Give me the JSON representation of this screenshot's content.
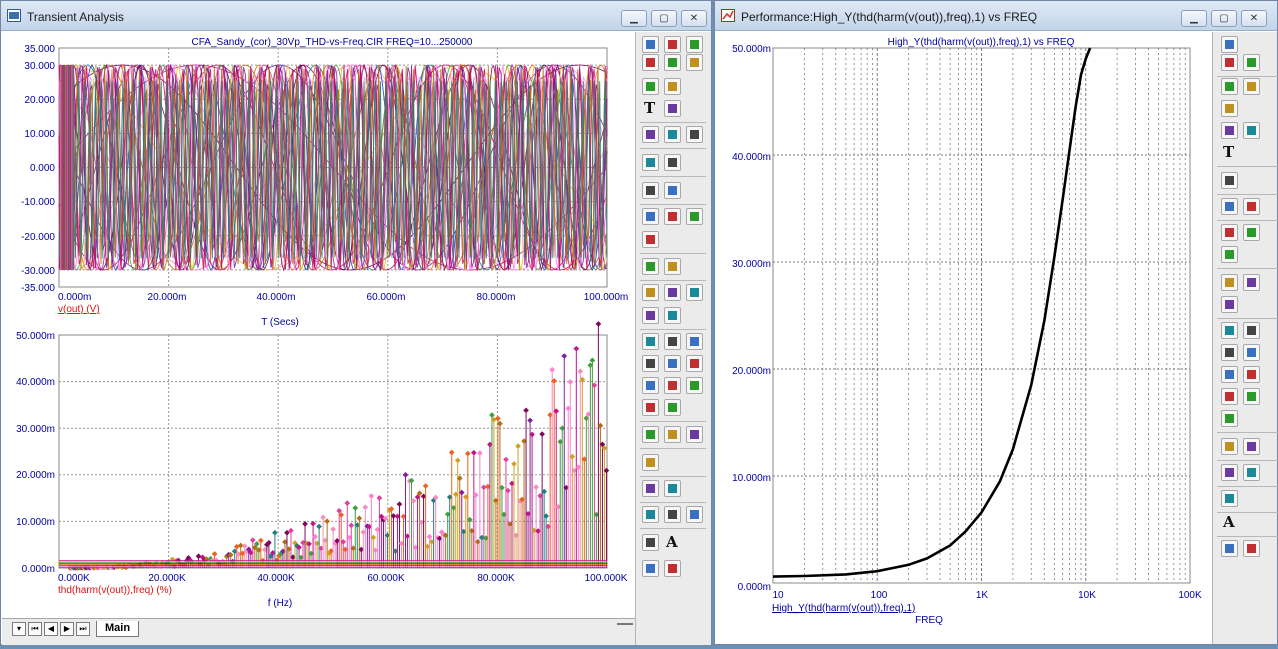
{
  "left_window": {
    "title": "Transient Analysis",
    "top_plot": {
      "title": "CFA_Sandy_(cor)_30Vp_THD-vs-Freq.CIR FREQ=10...250000",
      "y_ticks": [
        "35.000",
        "30.000",
        "20.000",
        "10.000",
        "0.000",
        "-10.000",
        "-20.000",
        "-30.000",
        "-35.000"
      ],
      "x_ticks": [
        "0.000m",
        "20.000m",
        "40.000m",
        "60.000m",
        "80.000m",
        "100.000m"
      ],
      "trace_label": "v(out) (V)",
      "x_label": "T (Secs)"
    },
    "bottom_plot": {
      "y_ticks": [
        "50.000m",
        "40.000m",
        "30.000m",
        "20.000m",
        "10.000m",
        "0.000m"
      ],
      "x_ticks": [
        "0.000K",
        "20.000K",
        "40.000K",
        "60.000K",
        "80.000K",
        "100.000K"
      ],
      "trace_label": "thd(harm(v(out)),freq) (%)",
      "x_label": "f (Hz)"
    },
    "tabs": [
      {
        "label": "Main"
      }
    ]
  },
  "right_window": {
    "title": "Performance:High_Y(thd(harm(v(out)),freq),1) vs FREQ",
    "plot_title": "High_Y(thd(harm(v(out)),freq),1) vs FREQ",
    "y_ticks": [
      "50.000m",
      "40.000m",
      "30.000m",
      "20.000m",
      "10.000m",
      "0.000m"
    ],
    "x_ticks": [
      "10",
      "100",
      "1K",
      "10K",
      "100K"
    ],
    "trace_label": "High_Y(thd(harm(v(out)),freq),1)",
    "x_label": "FREQ",
    "chart_data": {
      "type": "line",
      "title": "High_Y(thd(harm(v(out)),freq),1) vs FREQ",
      "xlabel": "FREQ",
      "ylabel": "",
      "x_scale": "log",
      "xlim": [
        10,
        100000
      ],
      "ylim": [
        0,
        0.05
      ],
      "series": [
        {
          "name": "High_Y(thd(harm(v(out)),freq),1)",
          "color": "#000000",
          "x": [
            10,
            20,
            50,
            100,
            200,
            300,
            500,
            700,
            1000,
            1500,
            2000,
            3000,
            4000,
            5000,
            6000,
            7000,
            8000,
            9000,
            10000,
            11000
          ],
          "y": [
            0.0006,
            0.00065,
            0.0008,
            0.0011,
            0.0017,
            0.0023,
            0.0035,
            0.0048,
            0.0066,
            0.0095,
            0.0125,
            0.0185,
            0.0245,
            0.0305,
            0.0358,
            0.0405,
            0.0445,
            0.0475,
            0.049,
            0.05
          ]
        }
      ]
    }
  },
  "colors": {
    "tick_text": "#0000a0",
    "trace_label": "#e01010",
    "title_text": "#0000a0",
    "grid": "#7a7a7a",
    "thd_curve": "#000000"
  }
}
